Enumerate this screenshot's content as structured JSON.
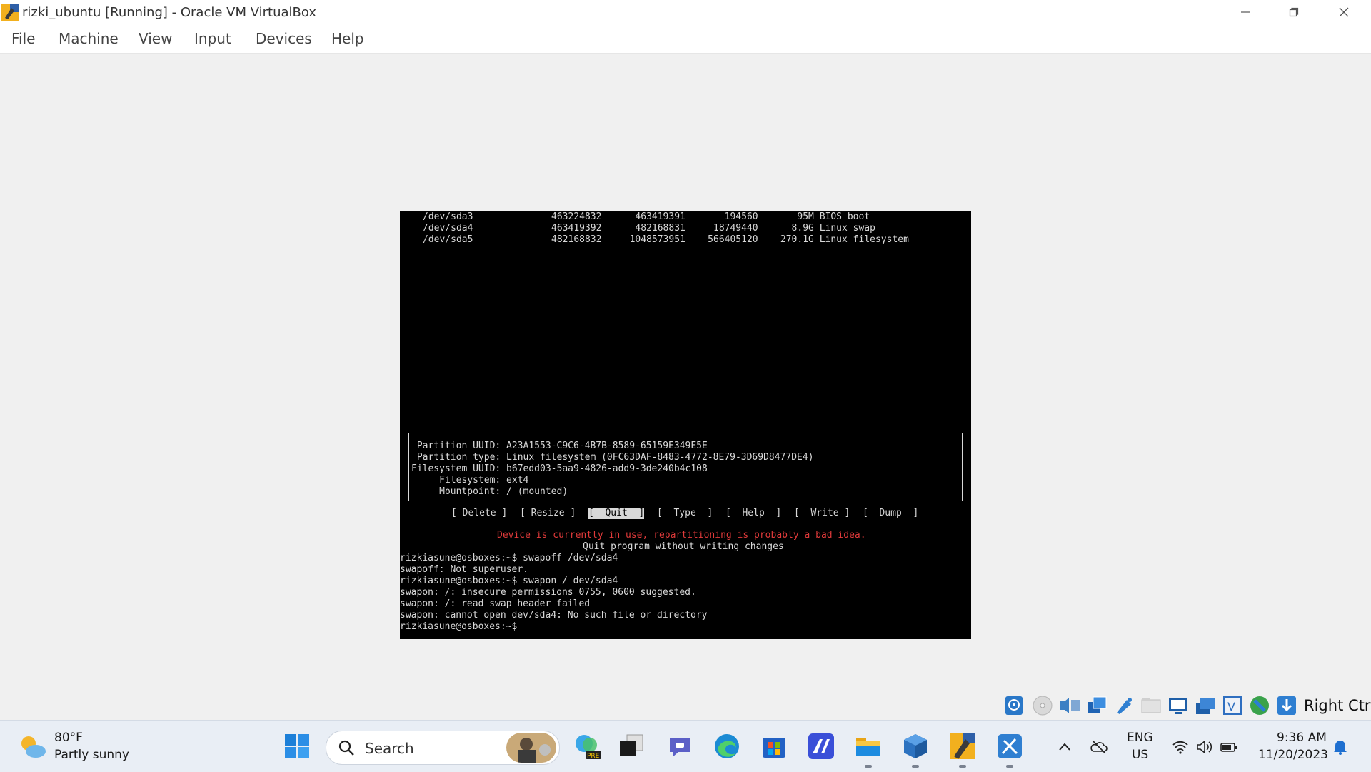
{
  "window": {
    "title": "rizki_ubuntu [Running] - Oracle VM VirtualBox"
  },
  "menu": {
    "file": "File",
    "machine": "Machine",
    "view": "View",
    "input": "Input",
    "devices": "Devices",
    "help": "Help"
  },
  "terminal": {
    "partitions": [
      "/dev/sda3              463224832      463419391       194560       95M BIOS boot",
      "/dev/sda4              463419392      482168831     18749440      8.9G Linux swap",
      "/dev/sda5              482168832     1048573951    566405120    270.1G Linux filesystem"
    ],
    "info": [
      " Partition UUID: A23A1553-C9C6-4B7B-8589-65159E349E5E",
      " Partition type: Linux filesystem (0FC63DAF-8483-4772-8E79-3D69D8477DE4)",
      "Filesystem UUID: b67edd03-5aa9-4826-add9-3de240b4c108",
      "     Filesystem: ext4",
      "     Mountpoint: / (mounted)"
    ],
    "buttons": {
      "delete": "[ Delete ]",
      "resize": "[ Resize ]",
      "quit": "[  Quit  ]",
      "type": "[  Type  ]",
      "help": "[  Help  ]",
      "write": "[  Write ]",
      "dump": "[  Dump  ]"
    },
    "warning": "Device is currently in use, repartitioning is probably a bad idea.",
    "hint": "Quit program without writing changes",
    "shell": [
      "rizkiasune@osboxes:~$ swapoff /dev/sda4",
      "swapoff: Not superuser.",
      "rizkiasune@osboxes:~$ swapon / dev/sda4",
      "swapon: /: insecure permissions 0755, 0600 suggested.",
      "swapon: /: read swap header failed",
      "swapon: cannot open dev/sda4: No such file or directory",
      "rizkiasune@osboxes:~$"
    ]
  },
  "statusbar": {
    "host_key": "Right Ctrl"
  },
  "taskbar": {
    "weather_temp": "80°F",
    "weather_desc": "Partly sunny",
    "search_placeholder": "Search",
    "search_badge": "PRE",
    "lang_top": "ENG",
    "lang_bottom": "US",
    "time": "9:36 AM",
    "date": "11/20/2023"
  }
}
